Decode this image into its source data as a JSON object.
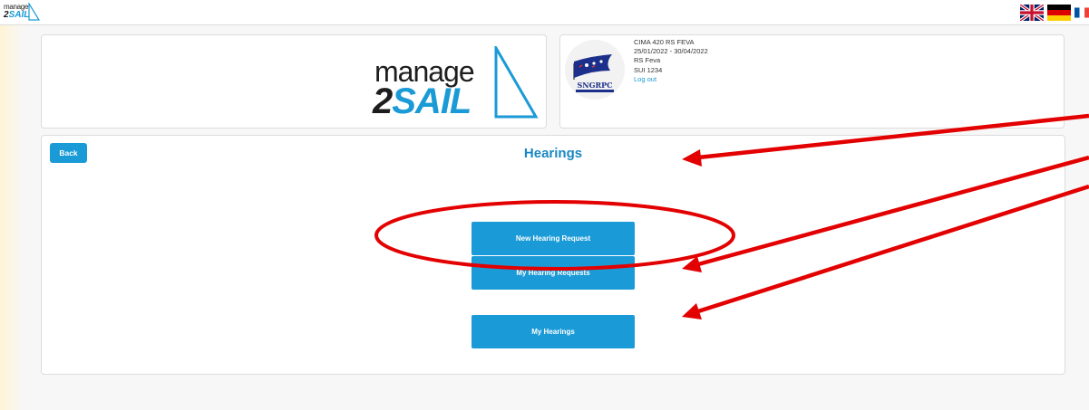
{
  "header": {
    "logo_small_top": "manage",
    "logo_small_bottom_a": "2",
    "logo_small_bottom_b": "SAIL",
    "languages": [
      "English",
      "Deutsch",
      "Français"
    ]
  },
  "logo": {
    "line1": "manage",
    "line2_a": "2",
    "line2_b": "SAIL"
  },
  "club": {
    "icon": "club-burgee-logo",
    "text": "SNGRPC"
  },
  "event": {
    "name": "CIMA 420 RS FEVA",
    "dates": "25/01/2022 - 30/04/2022",
    "boat_class": "RS Feva",
    "sail_number": "SUI 1234",
    "logout": "Log out"
  },
  "main": {
    "back_label": "Back",
    "title": "Hearings",
    "buttons": [
      {
        "label": "New Hearing Request"
      },
      {
        "label": "My Hearing Requests"
      },
      {
        "label": "My Hearings"
      }
    ]
  },
  "colors": {
    "accent": "#1a9ad6",
    "title": "#1a87c2",
    "annotation": "#e30000"
  }
}
